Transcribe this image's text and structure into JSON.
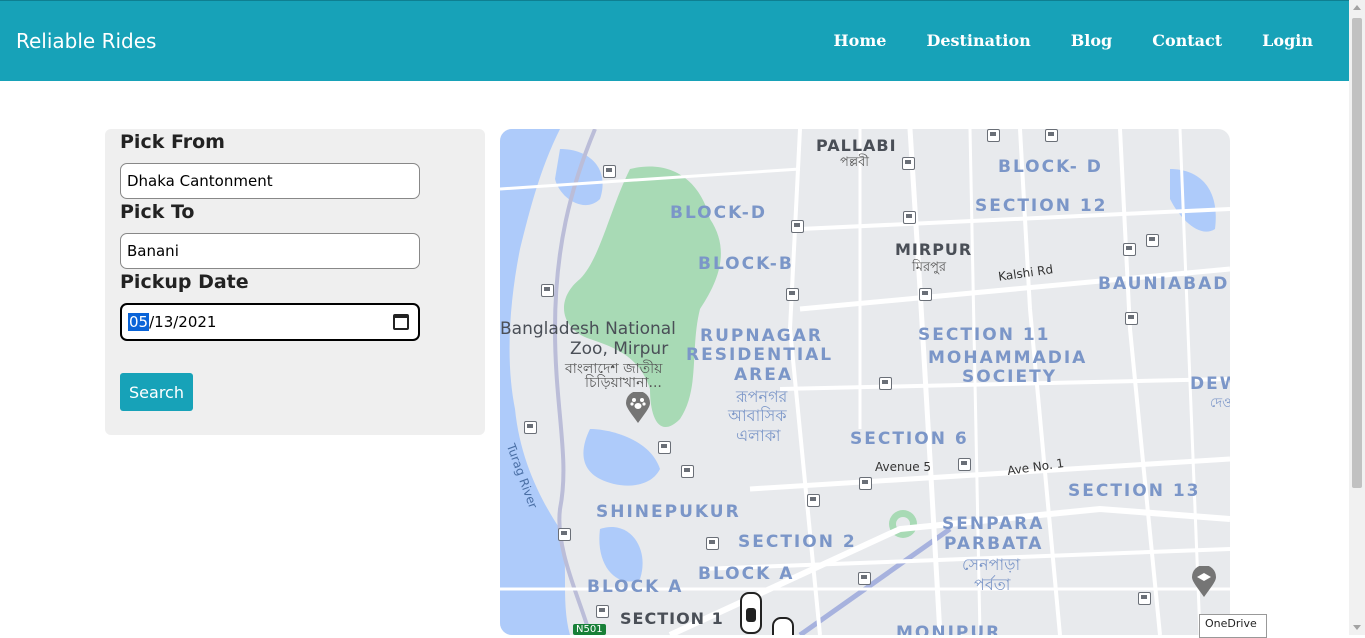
{
  "navbar": {
    "brand": "Reliable Rides",
    "links": [
      "Home",
      "Destination",
      "Blog",
      "Contact",
      "Login"
    ]
  },
  "form": {
    "pick_from_label": "Pick From",
    "pick_from_value": "Dhaka Cantonment",
    "pick_to_label": "Pick To",
    "pick_to_value": "Banani",
    "pickup_date_label": "Pickup Date",
    "date_month": "05",
    "date_rest": "/13/2021",
    "search_label": "Search"
  },
  "map": {
    "area_labels": [
      "PALLABI",
      "BLOCK- D",
      "SECTION 12",
      "BLOCK-D",
      "BLOCK-B",
      "MIRPUR",
      "BAUNIABAD",
      "RUPNAGAR",
      "RESIDENTIAL",
      "AREA",
      "SECTION 11",
      "MOHAMMADIA",
      "SOCIETY",
      "SECTION 6",
      "SECTION 13",
      "SHINEPUKUR",
      "SENPARA",
      "PARBATA",
      "SECTION 2",
      "BLOCK A",
      "BLOCK A",
      "SECTION 1",
      "DEW",
      "MONIPUR"
    ],
    "place_labels": [
      "Bangladesh National",
      "Zoo, Mirpur"
    ],
    "bengali_labels": [
      "পল্লবী",
      "মিরপুর",
      "বাংলাদেশ জাতীয়",
      "চিড়িয়াখানা...",
      "রূপনগর",
      "আবাসিক",
      "এলাকা",
      "সেনপাড়া",
      "পর্বতা",
      "দেও"
    ],
    "road_labels": [
      "Kalshi Rd",
      "Avenue 5",
      "Ave No. 1",
      "N501"
    ],
    "river_label": "Turag River"
  },
  "overlay": {
    "onedrive": "OneDrive"
  },
  "colors": {
    "navbar": "#17a2b8",
    "button": "#17a2b8",
    "card": "#efefef"
  }
}
